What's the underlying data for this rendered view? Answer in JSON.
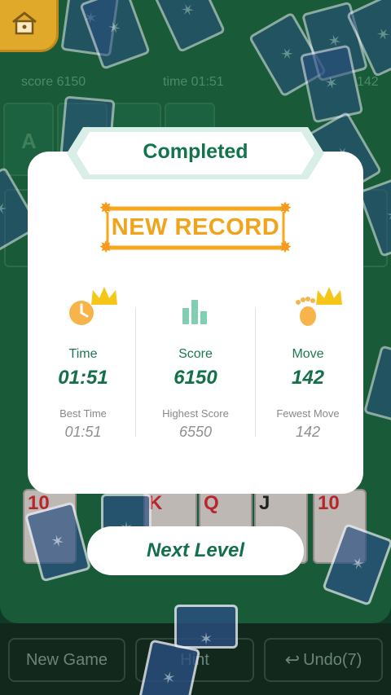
{
  "topbar": {
    "score_text": "score 6150",
    "time_text": "time  01:51",
    "moves_text": "142"
  },
  "board": {
    "foundation_label": "A"
  },
  "tableau_faces": [
    "10",
    "K",
    "Q",
    "J",
    "10"
  ],
  "dialog": {
    "title": "Completed",
    "badge": "NEW RECORD",
    "stats": [
      {
        "title": "Time",
        "value": "01:51",
        "sub_label": "Best Time",
        "sub_value": "01:51",
        "icon": "clock-crown-icon"
      },
      {
        "title": "Score",
        "value": "6150",
        "sub_label": "Highest Score",
        "sub_value": "6550",
        "icon": "bar-chart-icon"
      },
      {
        "title": "Move",
        "value": "142",
        "sub_label": "Fewest Move",
        "sub_value": "142",
        "icon": "footprint-crown-icon"
      }
    ],
    "next_label": "Next Level"
  },
  "bottom": {
    "new_game": "New Game",
    "hint": "Hint",
    "undo": "Undo(7)"
  },
  "colors": {
    "accent_green": "#13734a",
    "record_orange": "#f0a41c",
    "crown_gold": "#f5c518"
  }
}
